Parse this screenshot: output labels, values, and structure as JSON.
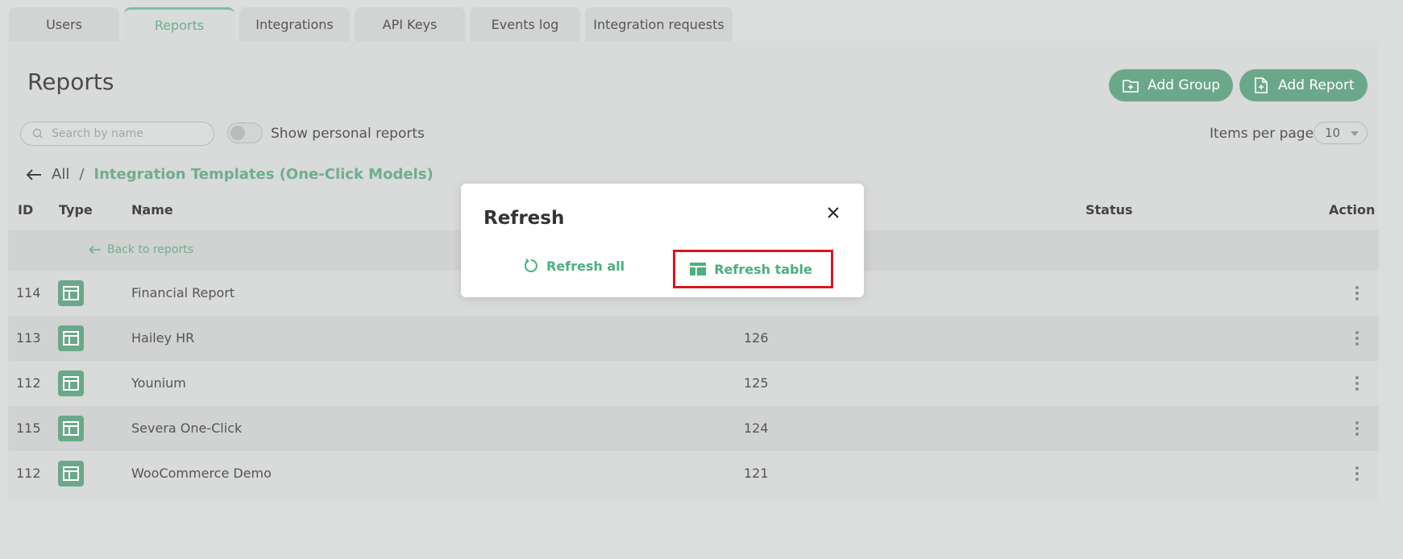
{
  "tabs": [
    {
      "label": "Users",
      "active": false
    },
    {
      "label": "Reports",
      "active": true
    },
    {
      "label": "Integrations",
      "active": false
    },
    {
      "label": "API Keys",
      "active": false
    },
    {
      "label": "Events log",
      "active": false
    },
    {
      "label": "Integration requests",
      "active": false
    }
  ],
  "page": {
    "title": "Reports"
  },
  "actions": {
    "add_group": "Add Group",
    "add_report": "Add Report"
  },
  "search": {
    "placeholder": "Search by name"
  },
  "toggle": {
    "label": "Show personal reports",
    "on": false
  },
  "pagination": {
    "label": "Items per page",
    "value": "10"
  },
  "breadcrumb": {
    "all": "All",
    "separator": "/",
    "current": "Integration Templates (One-Click Models)"
  },
  "table": {
    "headers": {
      "id": "ID",
      "type": "Type",
      "name": "Name",
      "status": "Status",
      "action": "Action"
    },
    "back_link": "Back to reports",
    "rows": [
      {
        "id": "114",
        "name": "Financial Report",
        "num": ""
      },
      {
        "id": "113",
        "name": "Hailey HR",
        "num": "126"
      },
      {
        "id": "112",
        "name": "Younium",
        "num": "125"
      },
      {
        "id": "115",
        "name": "Severa One-Click",
        "num": "124"
      },
      {
        "id": "112",
        "name": "WooCommerce Demo",
        "num": "121"
      }
    ]
  },
  "modal": {
    "title": "Refresh",
    "refresh_all": "Refresh all",
    "refresh_table": "Refresh table"
  },
  "colors": {
    "accent": "#6ba88a",
    "accent_text": "#4bb07e",
    "highlight": "#e0141e"
  }
}
